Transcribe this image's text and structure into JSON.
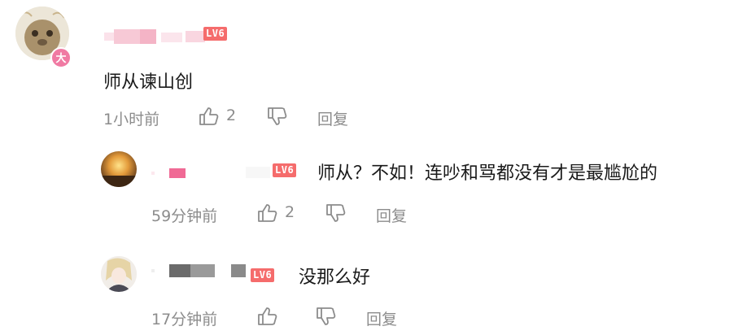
{
  "main_comment": {
    "level": "LV6",
    "avatar_badge": "大",
    "text": "师从谏山创",
    "time": "1小时前",
    "likes": "2",
    "reply_label": "回复"
  },
  "replies": [
    {
      "level": "LV6",
      "text": "师从？不如！连吵和骂都没有才是最尴尬的",
      "time": "59分钟前",
      "likes": "2",
      "reply_label": "回复"
    },
    {
      "level": "LV6",
      "text": "没那么好",
      "time": "17分钟前",
      "reply_label": "回复"
    }
  ],
  "icons": {
    "like": "thumbs-up-icon",
    "dislike": "thumbs-down-icon"
  },
  "colors": {
    "level_badge": "#f56c6c",
    "avatar_badge": "#f07aa3",
    "meta_text": "#8c8c8c"
  }
}
